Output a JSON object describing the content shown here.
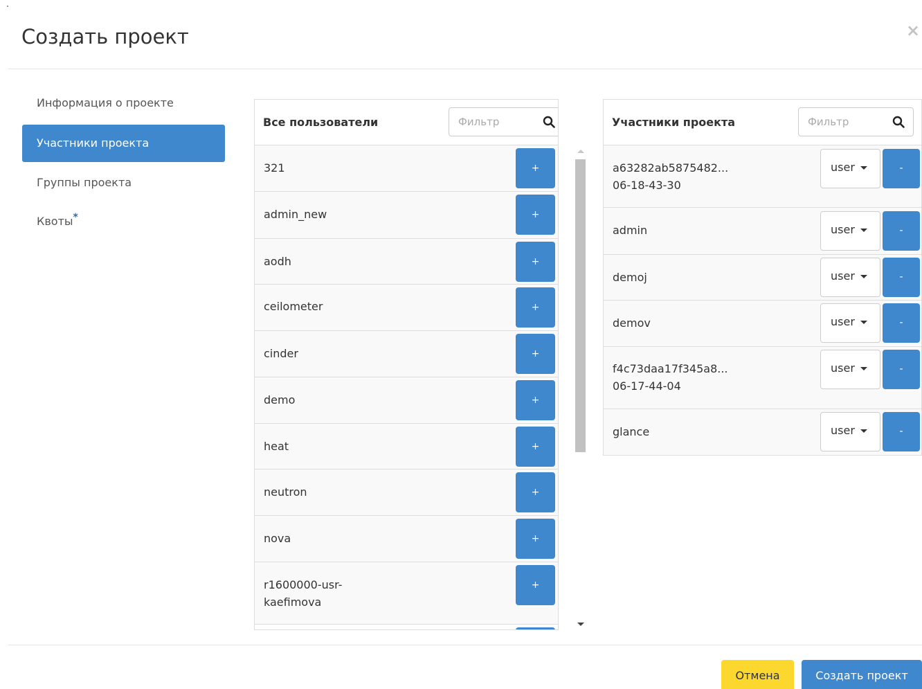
{
  "modal": {
    "title": "Создать проект",
    "close_icon": "×"
  },
  "nav": [
    {
      "label": "Информация о проекте"
    },
    {
      "label": "Участники проекта"
    },
    {
      "label": "Группы проекта"
    },
    {
      "label": "Квоты",
      "required_mark": "*"
    }
  ],
  "all_users": {
    "title": "Все пользователи",
    "filter_placeholder": "Фильтр",
    "add_label": "+",
    "rows": [
      {
        "name": "321"
      },
      {
        "name": "admin_new"
      },
      {
        "name": "aodh"
      },
      {
        "name": "ceilometer"
      },
      {
        "name": "cinder"
      },
      {
        "name": "demo"
      },
      {
        "name": "heat"
      },
      {
        "name": "neutron"
      },
      {
        "name": "nova"
      },
      {
        "name": "r1600000-usr-",
        "name2": "kaefimova"
      }
    ]
  },
  "members": {
    "title": "Участники проекта",
    "filter_placeholder": "Фильтр",
    "remove_label": "-",
    "rows": [
      {
        "name": "a63282ab5875482...",
        "name2": "06-18-43-30",
        "role": "user"
      },
      {
        "name": "admin",
        "role": "user"
      },
      {
        "name": "demoj",
        "role": "user"
      },
      {
        "name": "demov",
        "role": "user"
      },
      {
        "name": "f4c73daa17f345a8...",
        "name2": "06-17-44-04",
        "role": "user"
      },
      {
        "name": "glance",
        "role": "user"
      }
    ]
  },
  "footer": {
    "cancel": "Отмена",
    "create": "Создать проект"
  }
}
